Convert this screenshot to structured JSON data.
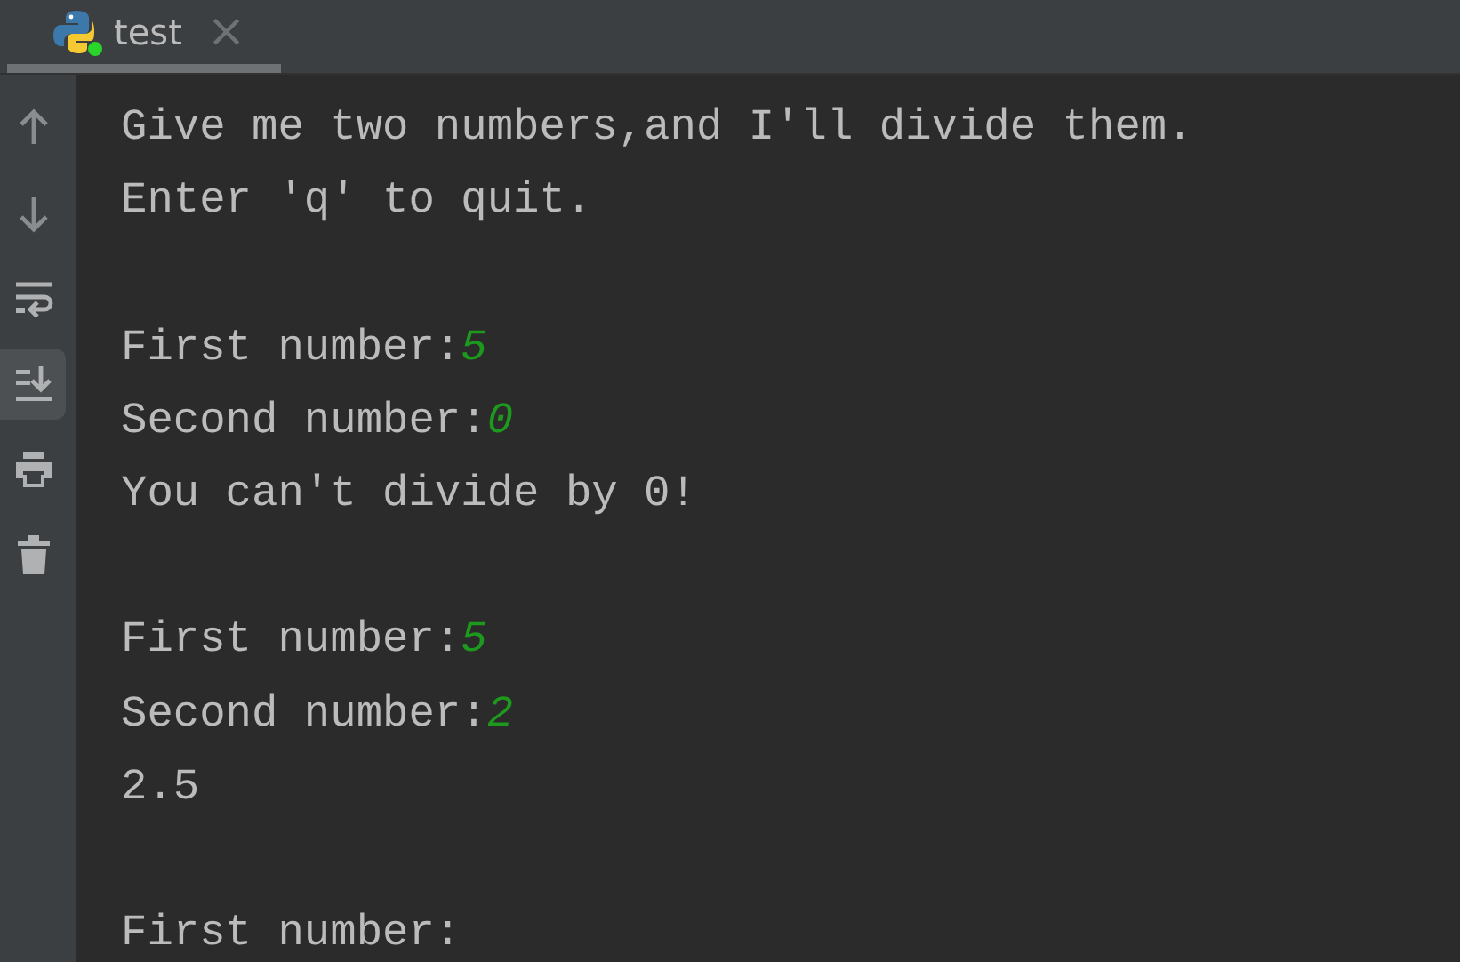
{
  "tab": {
    "label": "test",
    "selected": true,
    "close": "×"
  },
  "toolbar": [
    {
      "kind": "up",
      "selected": false
    },
    {
      "kind": "down",
      "selected": false
    },
    {
      "kind": "wrap",
      "selected": false
    },
    {
      "kind": "scroll-end",
      "selected": true
    },
    {
      "kind": "print",
      "selected": false
    },
    {
      "kind": "delete",
      "selected": false
    }
  ],
  "console_lines": [
    {
      "kind": "text",
      "segments": [
        {
          "kind": "output",
          "text": "Give me two numbers,and I'll divide them."
        }
      ]
    },
    {
      "kind": "text",
      "segments": [
        {
          "kind": "output",
          "text": "Enter 'q' to quit."
        }
      ]
    },
    {
      "kind": "blank"
    },
    {
      "kind": "text",
      "segments": [
        {
          "kind": "output",
          "text": "First number:"
        },
        {
          "kind": "input",
          "text": "5"
        }
      ]
    },
    {
      "kind": "text",
      "segments": [
        {
          "kind": "output",
          "text": "Second number:"
        },
        {
          "kind": "input",
          "text": "0"
        }
      ]
    },
    {
      "kind": "text",
      "segments": [
        {
          "kind": "output",
          "text": "You can't divide by 0!"
        }
      ]
    },
    {
      "kind": "blank"
    },
    {
      "kind": "text",
      "segments": [
        {
          "kind": "output",
          "text": "First number:"
        },
        {
          "kind": "input",
          "text": "5"
        }
      ]
    },
    {
      "kind": "text",
      "segments": [
        {
          "kind": "output",
          "text": "Second number:"
        },
        {
          "kind": "input",
          "text": "2"
        }
      ]
    },
    {
      "kind": "text",
      "segments": [
        {
          "kind": "output",
          "text": "2.5"
        }
      ]
    },
    {
      "kind": "blank"
    },
    {
      "kind": "text",
      "segments": [
        {
          "kind": "output",
          "text": "First number:"
        }
      ]
    }
  ]
}
